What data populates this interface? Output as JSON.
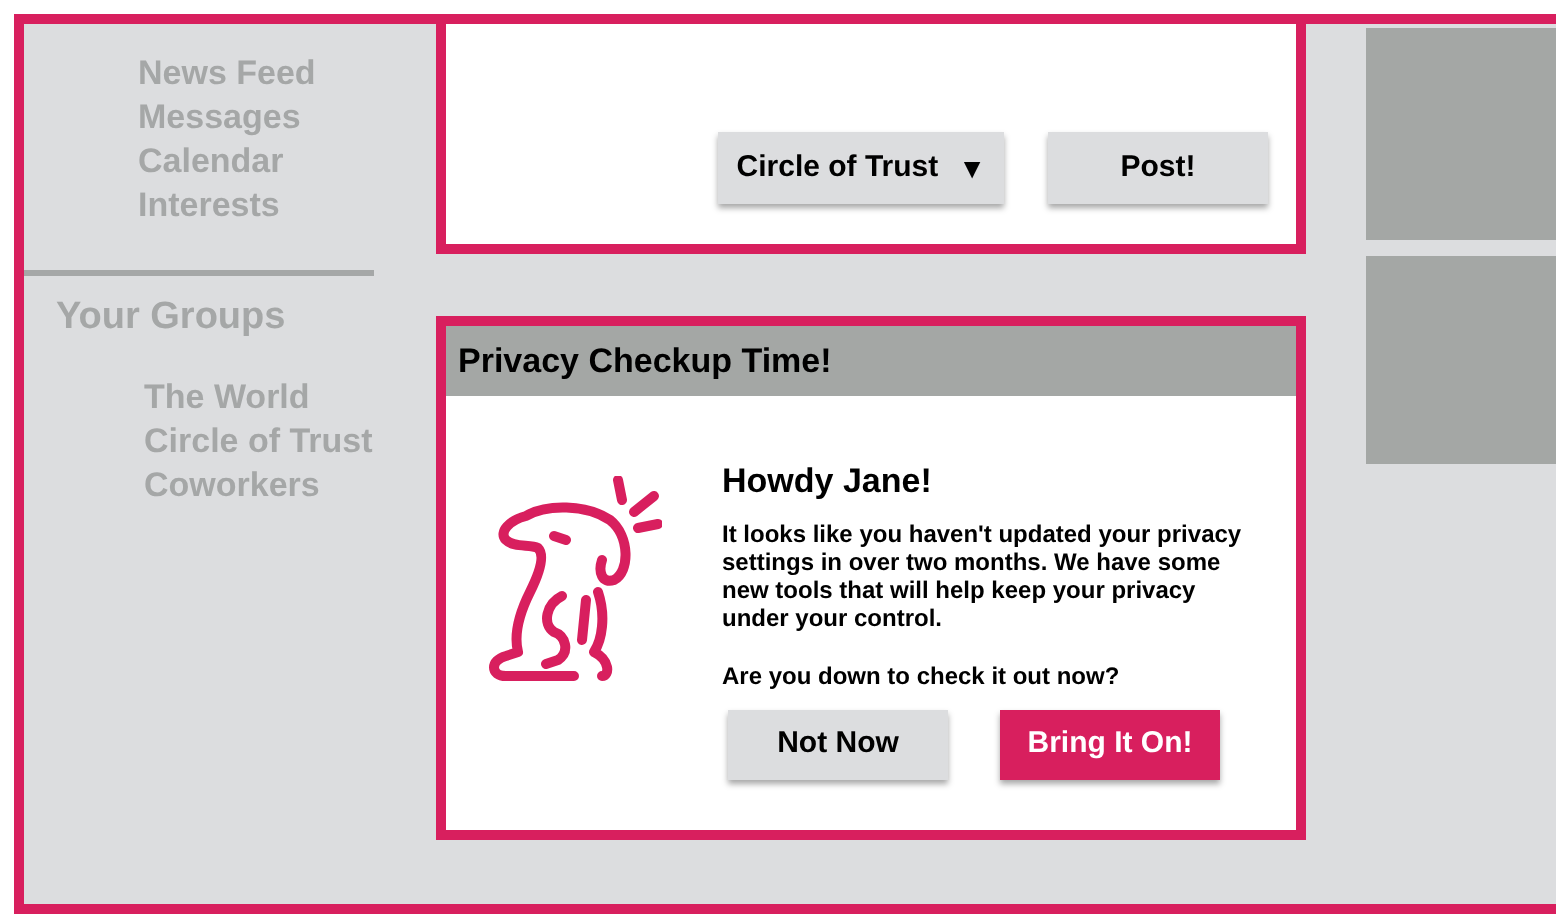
{
  "sidebar": {
    "nav_items": [
      {
        "label": "News Feed"
      },
      {
        "label": "Messages"
      },
      {
        "label": "Calendar"
      },
      {
        "label": "Interests"
      }
    ],
    "groups_title": "Your Groups",
    "groups": [
      {
        "label": "The World"
      },
      {
        "label": "Circle of Trust"
      },
      {
        "label": "Coworkers"
      }
    ]
  },
  "composer": {
    "audience_dropdown": {
      "label": "Circle of Trust",
      "caret": "▼"
    },
    "post_button": "Post!"
  },
  "modal": {
    "title": "Privacy Checkup Time!",
    "greeting": "Howdy Jane!",
    "message": "It looks like you haven't updated your privacy settings in over two months. We have some new tools that will help keep your privacy under your control.",
    "question": "Are you down to check it out now?",
    "buttons": [
      {
        "label": "Not Now",
        "kind": "secondary"
      },
      {
        "label": "Bring It On!",
        "kind": "primary"
      }
    ]
  }
}
